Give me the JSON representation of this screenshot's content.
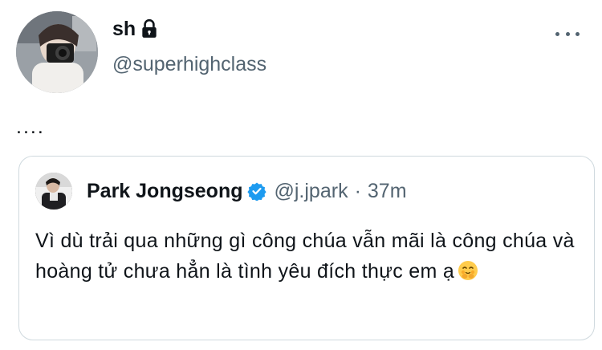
{
  "author": {
    "display_name": "sh",
    "handle": "@superhighclass",
    "protected": true
  },
  "tweet": {
    "text": "...."
  },
  "quoted_tweet": {
    "display_name": "Park Jongseong",
    "verified": true,
    "handle": "@j.jpark",
    "separator": "·",
    "time": "37m",
    "body": "Vì dù trải qua những gì công chúa vẫn mãi là công chúa và hoàng tử chưa hẳn là tình yêu đích thực em ạ"
  },
  "colors": {
    "text": "#0f1419",
    "secondary": "#536471",
    "border": "#cfd9de",
    "verified": "#1d9bf0"
  },
  "icons": [
    "lock-icon",
    "more-icon",
    "verified-badge-icon",
    "hugging-face-emoji-icon"
  ]
}
